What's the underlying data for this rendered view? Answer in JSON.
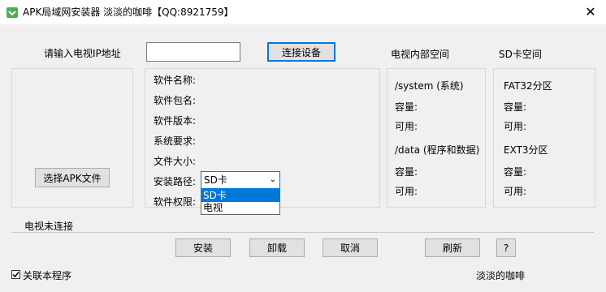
{
  "window": {
    "title": "APK局域网安装器    淡淡的咖啡【QQ:8921759】",
    "close_glyph": "✕"
  },
  "connection": {
    "ip_label": "请输入电视IP地址",
    "ip_value": "",
    "connect_button": "连接设备",
    "status": "电视未连接"
  },
  "file": {
    "select_button": "选择APK文件"
  },
  "info": {
    "name_label": "软件名称:",
    "package_label": "软件包名:",
    "version_label": "软件版本:",
    "requirement_label": "系统要求:",
    "size_label": "文件大小:",
    "path_label": "安装路径:",
    "permission_label": "软件权限:",
    "path_selected": "SD卡",
    "path_options": [
      "SD卡",
      "电视"
    ]
  },
  "internal": {
    "header": "电视内部空间",
    "system_title": "/system (系统)",
    "data_title": "/data (程序和数据)",
    "capacity_label": "容量:",
    "available_label": "可用:"
  },
  "sd": {
    "header": "SD卡空间",
    "fat32_title": "FAT32分区",
    "ext3_title": "EXT3分区",
    "capacity_label": "容量:",
    "available_label": "可用:"
  },
  "actions": {
    "install": "安装",
    "uninstall": "卸载",
    "cancel": "取消",
    "refresh": "刷新",
    "help": "?"
  },
  "footer": {
    "associate_label": "关联本程序",
    "associate_checked": true,
    "author": "淡淡的咖啡"
  },
  "colors": {
    "accent": "#0078d7",
    "icon": "#4caf50"
  }
}
